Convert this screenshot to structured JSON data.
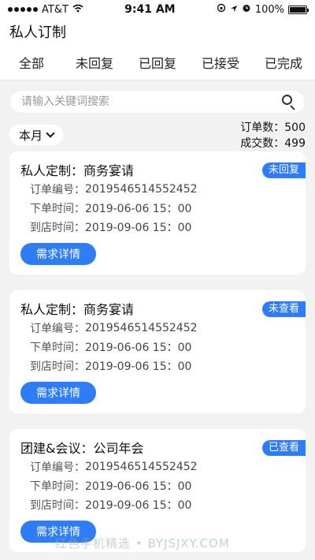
{
  "status": {
    "carrier": "AT&T",
    "time": "9:41 AM",
    "battery": "100%",
    "battery_level": 1.0
  },
  "header": {
    "title": "私人订制"
  },
  "tabs": [
    {
      "label": "全部",
      "active": true
    },
    {
      "label": "未回复",
      "active": false
    },
    {
      "label": "已回复",
      "active": false
    },
    {
      "label": "已接受",
      "active": false
    },
    {
      "label": "已完成",
      "active": false
    }
  ],
  "search": {
    "placeholder": "请输入关键词搜索",
    "value": ""
  },
  "filter": {
    "month_label": "本月"
  },
  "stats": {
    "orders_label": "订单数：500",
    "deals_label": "成交数：499"
  },
  "cards": [
    {
      "title": "私人定制：商务宴请",
      "badge": "未回复",
      "order_no_label": "订单编号：",
      "order_no": "2019546514552452",
      "order_time_label": "下单时间：",
      "order_time": "2019-06-06 15：00",
      "arrive_time_label": "到店时间：",
      "arrive_time": "2019-09-06 15：00",
      "button": "需求详情"
    },
    {
      "title": "私人定制：商务宴请",
      "badge": "未查看",
      "order_no_label": "订单编号：",
      "order_no": "2019546514552452",
      "order_time_label": "下单时间：",
      "order_time": "2019-06-06 15：00",
      "arrive_time_label": "到店时间：",
      "arrive_time": "2019-09-06 15：00",
      "button": "需求详情"
    },
    {
      "title": "团建&会议：公司年会",
      "badge": "已查看",
      "order_no_label": "订单编号：",
      "order_no": "2019546514552452",
      "order_time_label": "下单时间：",
      "order_time": "2019-06-06 15：00",
      "arrive_time_label": "到店时间：",
      "arrive_time": "2019-09-06 15：00",
      "button": "需求详情"
    }
  ],
  "watermark": "红色手机精选 • BYJSJXY.COM",
  "colors": {
    "accent": "#2e7cf6",
    "background": "#f2f2f2"
  }
}
